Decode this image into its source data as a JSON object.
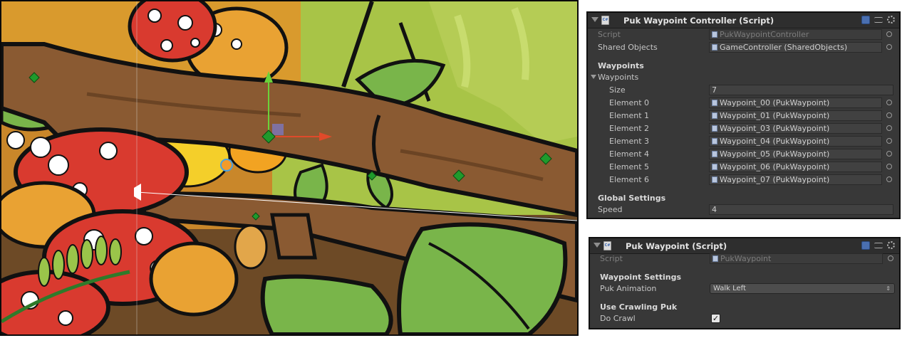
{
  "scene": {
    "colors": {
      "branch": "#8a5a32",
      "branch_dark": "#6b4424",
      "outline": "#111111",
      "leaf": "#79b54a",
      "mushroom_red": "#d93a2f",
      "mushroom_orange": "#e9a233",
      "sky_green": "#9bbf3a"
    },
    "gizmo": {
      "y_axis_color": "#6bd23a",
      "x_axis_color": "#e04a2a",
      "waypoint_color": "#1f9a2c"
    }
  },
  "controller": {
    "title": "Puk Waypoint Controller (Script)",
    "script_label": "Script",
    "script_value": "PukWaypointController",
    "shared_label": "Shared Objects",
    "shared_value": "GameController (SharedObjects)",
    "waypoints_header": "Waypoints",
    "waypoints_fold_label": "Waypoints",
    "size_label": "Size",
    "size_value": "7",
    "elements": [
      {
        "label": "Element 0",
        "value": "Waypoint_00 (PukWaypoint)"
      },
      {
        "label": "Element 1",
        "value": "Waypoint_01 (PukWaypoint)"
      },
      {
        "label": "Element 2",
        "value": "Waypoint_03 (PukWaypoint)"
      },
      {
        "label": "Element 3",
        "value": "Waypoint_04 (PukWaypoint)"
      },
      {
        "label": "Element 4",
        "value": "Waypoint_05 (PukWaypoint)"
      },
      {
        "label": "Element 5",
        "value": "Waypoint_06 (PukWaypoint)"
      },
      {
        "label": "Element 6",
        "value": "Waypoint_07 (PukWaypoint)"
      }
    ],
    "global_header": "Global Settings",
    "speed_label": "Speed",
    "speed_value": "4"
  },
  "waypoint": {
    "title": "Puk Waypoint (Script)",
    "script_label": "Script",
    "script_value": "PukWaypoint",
    "settings_header": "Waypoint Settings",
    "animation_label": "Puk Animation",
    "animation_value": "Walk Left",
    "crawl_header": "Use Crawling Puk",
    "crawl_label": "Do Crawl",
    "crawl_checked": true
  }
}
